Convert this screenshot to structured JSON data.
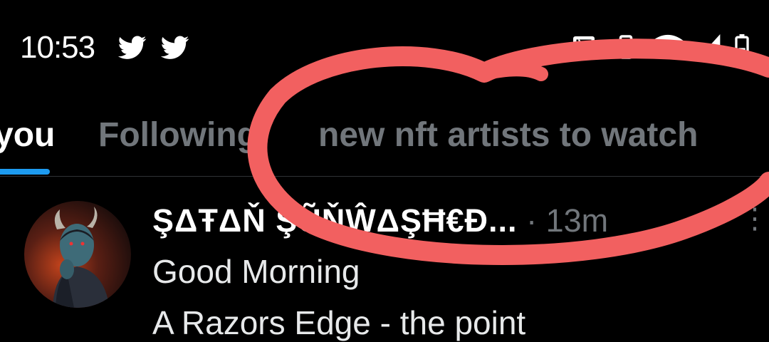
{
  "status_bar": {
    "time": "10:53",
    "notification_icons": [
      "twitter-bird-icon",
      "twitter-bird-icon"
    ],
    "system_icons": [
      "nfc-icon",
      "vibrate-icon",
      "wifi-icon",
      "cell-signal-icon",
      "battery-icon"
    ]
  },
  "tabs": [
    {
      "label": "you",
      "active": true
    },
    {
      "label": "Following",
      "active": false
    },
    {
      "label": "new nft artists to watch",
      "active": false
    }
  ],
  "accent_color": "#1d9bf0",
  "annotation_color": "#f26060",
  "tweet": {
    "author": "ŞΔŦΔŇ ŞŨŇŴΔŞĦ€Đ...",
    "separator": " · ",
    "time": "13m",
    "lines": [
      "Good Morning",
      "A Razors Edge - the point"
    ]
  }
}
